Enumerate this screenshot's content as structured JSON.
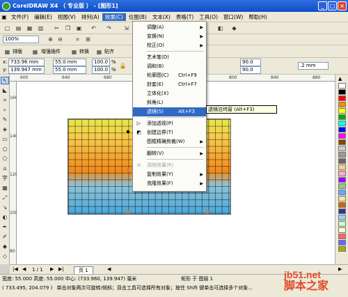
{
  "window": {
    "title": "CorelDRAW X4 （ 专业版 ） - [图形1]"
  },
  "window_controls": {
    "minimize": "_",
    "maximize": "□",
    "close": "×"
  },
  "menubar": [
    {
      "label": "文件(F)"
    },
    {
      "label": "编辑(E)"
    },
    {
      "label": "视图(V)"
    },
    {
      "label": "排列(A)"
    },
    {
      "label": "效果(C)",
      "active": true
    },
    {
      "label": "位图(B)"
    },
    {
      "label": "文本(X)"
    },
    {
      "label": "表格(T)"
    },
    {
      "label": "工具(O)"
    },
    {
      "label": "窗口(W)"
    },
    {
      "label": "帮助(H)"
    }
  ],
  "toolbar_standard": {
    "zoom": "100%"
  },
  "toolbar_plugins": {
    "layout_label": "排版",
    "plugin_label": "增强插件",
    "convert_label": "转换",
    "paste_label": "贴齐"
  },
  "property_bar": {
    "x": "733.96 mm",
    "y": "139.947 mm",
    "width": "55.0 mm",
    "height": "55.0 mm",
    "scale_x": "100.0",
    "scale_y": "100.0",
    "percent": "%",
    "angle1": "90.0",
    "angle2": "90.0",
    "outline": ".2 mm"
  },
  "ruler": {
    "h_ticks": [
      "600",
      "640",
      "680",
      "720",
      "760",
      "800",
      "840",
      "880"
    ],
    "v_ticks": [
      "160",
      "140",
      "120",
      "100",
      "80"
    ]
  },
  "effects_menu": {
    "items": [
      {
        "label": "调整(A)",
        "submenu": true
      },
      {
        "label": "变换(N)",
        "submenu": true
      },
      {
        "label": "校正(O)",
        "submenu": true
      },
      {
        "label": "艺术笔(D)"
      },
      {
        "label": "调和(B)"
      },
      {
        "label": "轮廓图(C)",
        "shortcut": "Ctrl+F9"
      },
      {
        "label": "封套(E)",
        "shortcut": "Ctrl+F7"
      },
      {
        "label": "立体化(X)"
      },
      {
        "label": "斜角(L)"
      },
      {
        "label": "透镜(S)",
        "shortcut": "Alt+F3",
        "selected": true
      },
      {
        "label": "添加透视(P)"
      },
      {
        "label": "创建边界(T)"
      },
      {
        "label": "图框精确剪裁(W)",
        "submenu": true
      },
      {
        "label": "翻转(V)",
        "submenu": true
      },
      {
        "label": "清除效果(R)",
        "disabled": true
      },
      {
        "label": "复制效果(Y)",
        "submenu": true
      },
      {
        "label": "克隆效果(F)",
        "submenu": true
      }
    ]
  },
  "tooltip": {
    "text": "透镜泊坞窗 (Alt+F3)"
  },
  "pagebar": {
    "page_info": "1 / 1",
    "page_tab": "页 1"
  },
  "status": {
    "size_info": "宽度: 55.000  高度: 55.000  中心: (733.960, 139.947) 毫米",
    "layer_info": "矩形 于 图层 1",
    "coords": "( 733.495, 204.079 )",
    "hint": "单击对象两次可旋转/倾斜；双击工具可选择所有对象；按住 Shift 键单击可选择多个对象..."
  },
  "watermark": {
    "line1": "jb51.net",
    "line2": "脚本之家"
  },
  "colors": {
    "accent": "#316ac5",
    "titlebar": "#0d4fc7",
    "gradient_top": "#e6e84a",
    "gradient_mid": "#f08a1c",
    "gradient_bottom": "#4aa6d9",
    "palette": [
      "#ffffff",
      "#000000",
      "#ff0000",
      "#ff8800",
      "#ffff00",
      "#00aa00",
      "#00ffff",
      "#0000ff",
      "#ff00ff",
      "#884400",
      "#cccccc",
      "#999999",
      "#666666",
      "#ffcc99",
      "#ffaacc",
      "#aa00ff",
      "#88cc88",
      "#66aaff",
      "#ffddaa",
      "#cc6600",
      "#333399",
      "#99ccff",
      "#ccffcc",
      "#ffffcc",
      "#ff6666",
      "#6666ff",
      "#aaaa00"
    ]
  }
}
